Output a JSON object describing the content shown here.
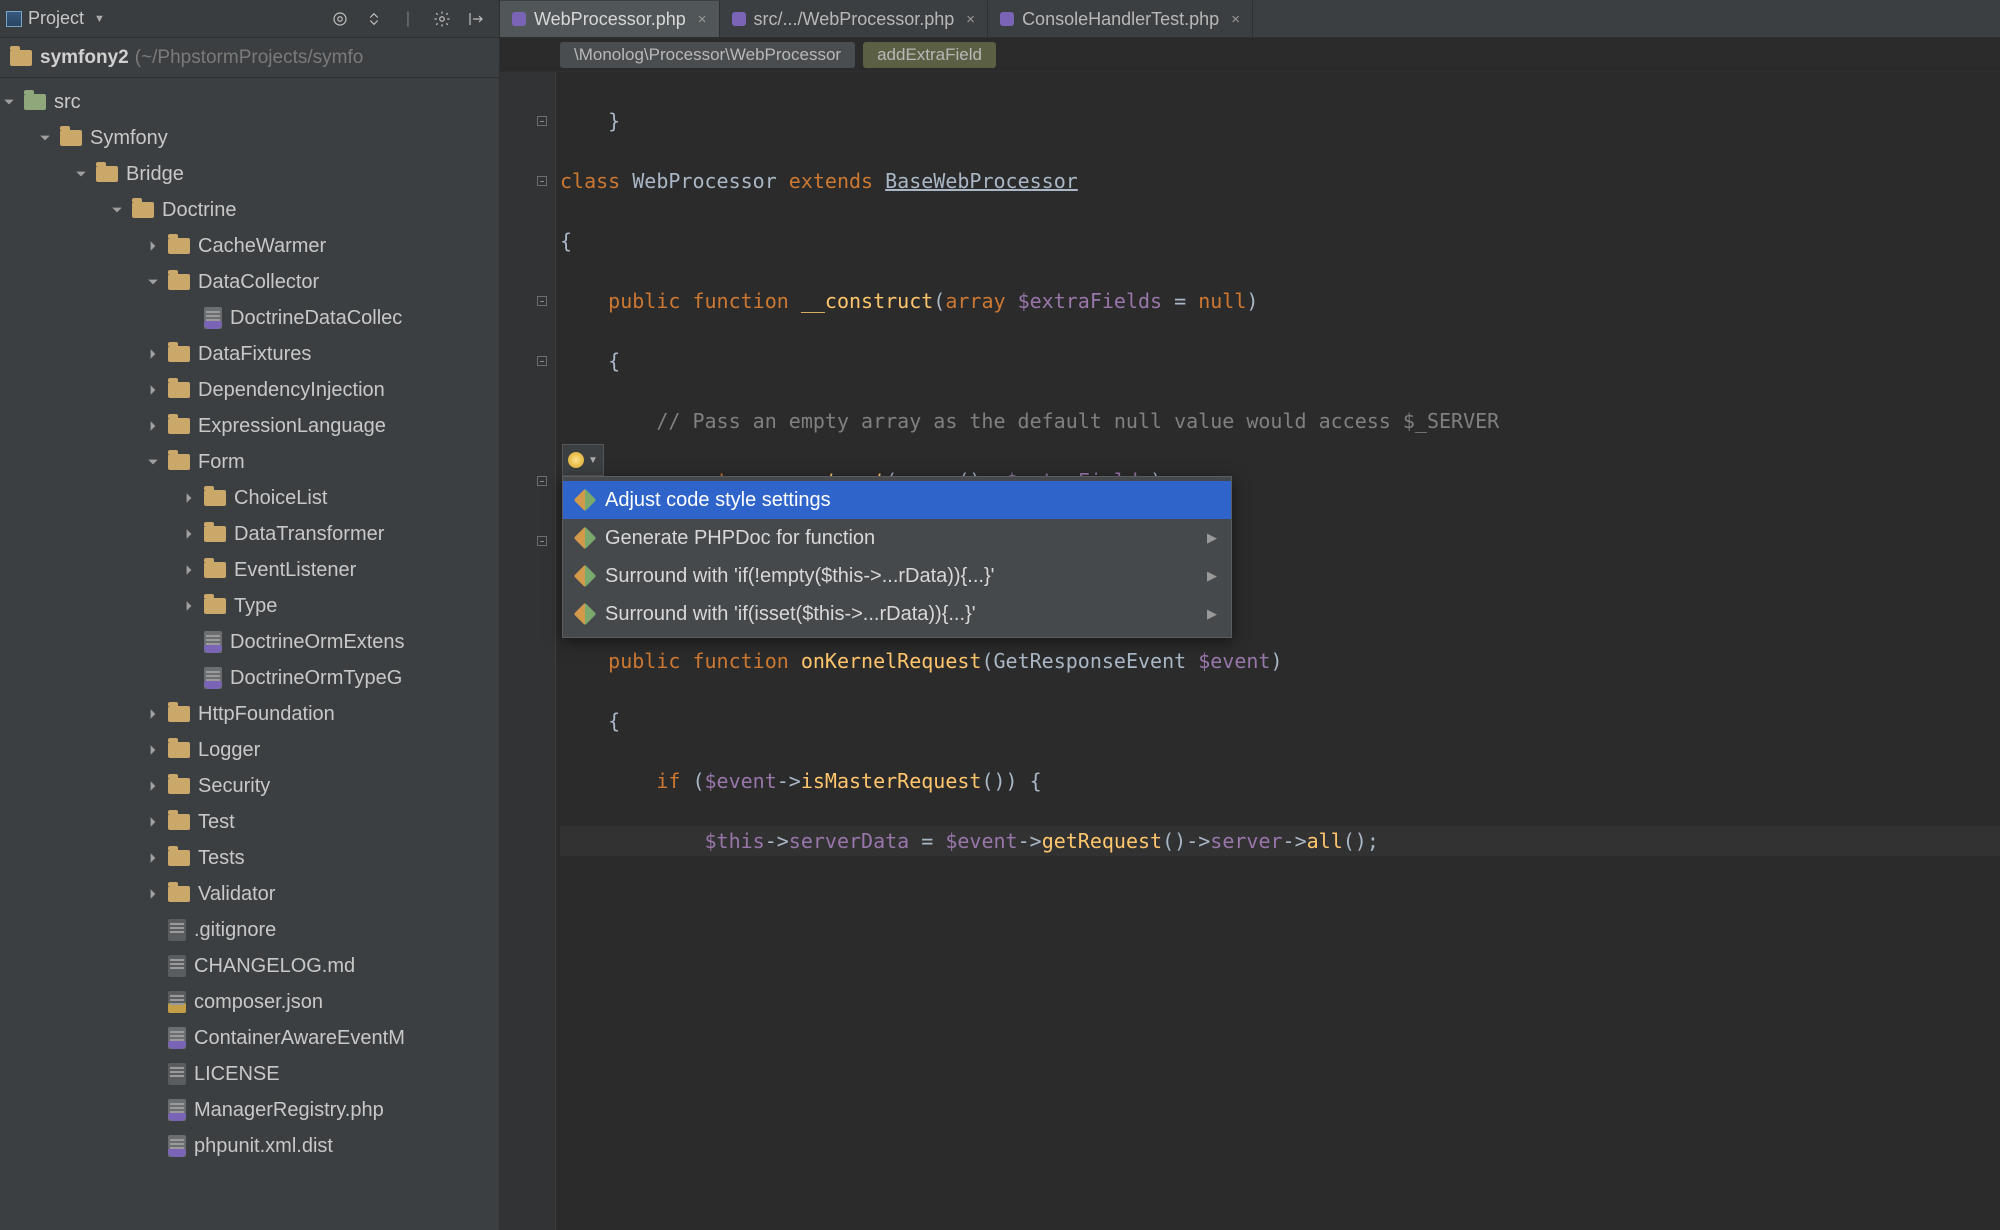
{
  "sidebar": {
    "title": "Project",
    "root_name": "symfony2",
    "root_path": "(~/PhpstormProjects/symfo",
    "tree": [
      {
        "depth": 0,
        "arr": "down",
        "icon": "folder-special",
        "label": "src"
      },
      {
        "depth": 1,
        "arr": "down",
        "icon": "folder",
        "label": "Symfony"
      },
      {
        "depth": 2,
        "arr": "down",
        "icon": "folder",
        "label": "Bridge"
      },
      {
        "depth": 3,
        "arr": "down",
        "icon": "folder",
        "label": "Doctrine"
      },
      {
        "depth": 4,
        "arr": "right",
        "icon": "folder",
        "label": "CacheWarmer"
      },
      {
        "depth": 4,
        "arr": "down",
        "icon": "folder",
        "label": "DataCollector"
      },
      {
        "depth": 5,
        "arr": "none",
        "icon": "php",
        "label": "DoctrineDataCollec"
      },
      {
        "depth": 4,
        "arr": "right",
        "icon": "folder",
        "label": "DataFixtures"
      },
      {
        "depth": 4,
        "arr": "right",
        "icon": "folder",
        "label": "DependencyInjection"
      },
      {
        "depth": 4,
        "arr": "right",
        "icon": "folder",
        "label": "ExpressionLanguage"
      },
      {
        "depth": 4,
        "arr": "down",
        "icon": "folder",
        "label": "Form"
      },
      {
        "depth": 5,
        "arr": "right",
        "icon": "folder",
        "label": "ChoiceList"
      },
      {
        "depth": 5,
        "arr": "right",
        "icon": "folder",
        "label": "DataTransformer"
      },
      {
        "depth": 5,
        "arr": "right",
        "icon": "folder",
        "label": "EventListener"
      },
      {
        "depth": 5,
        "arr": "right",
        "icon": "folder",
        "label": "Type"
      },
      {
        "depth": 5,
        "arr": "none",
        "icon": "php",
        "label": "DoctrineOrmExtens"
      },
      {
        "depth": 5,
        "arr": "none",
        "icon": "php",
        "label": "DoctrineOrmTypeG"
      },
      {
        "depth": 4,
        "arr": "right",
        "icon": "folder",
        "label": "HttpFoundation"
      },
      {
        "depth": 4,
        "arr": "right",
        "icon": "folder",
        "label": "Logger"
      },
      {
        "depth": 4,
        "arr": "right",
        "icon": "folder",
        "label": "Security"
      },
      {
        "depth": 4,
        "arr": "right",
        "icon": "folder",
        "label": "Test"
      },
      {
        "depth": 4,
        "arr": "right",
        "icon": "folder",
        "label": "Tests"
      },
      {
        "depth": 4,
        "arr": "right",
        "icon": "folder",
        "label": "Validator"
      },
      {
        "depth": 4,
        "arr": "none",
        "icon": "file",
        "label": ".gitignore"
      },
      {
        "depth": 4,
        "arr": "none",
        "icon": "file",
        "label": "CHANGELOG.md"
      },
      {
        "depth": 4,
        "arr": "none",
        "icon": "json",
        "label": "composer.json"
      },
      {
        "depth": 4,
        "arr": "none",
        "icon": "php",
        "label": "ContainerAwareEventM"
      },
      {
        "depth": 4,
        "arr": "none",
        "icon": "file",
        "label": "LICENSE"
      },
      {
        "depth": 4,
        "arr": "none",
        "icon": "php",
        "label": "ManagerRegistry.php"
      },
      {
        "depth": 4,
        "arr": "none",
        "icon": "php",
        "label": "phpunit.xml.dist"
      }
    ]
  },
  "tabs": [
    {
      "label": "WebProcessor.php",
      "active": true
    },
    {
      "label": "src/.../WebProcessor.php",
      "active": false
    },
    {
      "label": "ConsoleHandlerTest.php",
      "active": false
    }
  ],
  "crumbs": [
    {
      "label": "\\Monolog\\Processor\\WebProcessor",
      "hl": false
    },
    {
      "label": "addExtraField",
      "hl": true
    }
  ],
  "code": {
    "l1": "    }",
    "l2_a": "class ",
    "l2_b": "WebProcessor ",
    "l2_c": "extends ",
    "l2_d": "BaseWebProcessor",
    "l3": "{",
    "l4_a": "    public function ",
    "l4_b": "__construct",
    "l4_c": "(",
    "l4_d": "array ",
    "l4_e": "$extraFields",
    "l4_f": " = ",
    "l4_g": "null",
    "l4_h": ")",
    "l5": "    {",
    "l6": "        // Pass an empty array as the default null value would access $_SERVER",
    "l7_a": "        parent",
    "l7_b": "::",
    "l7_c": "__construct",
    "l7_d": "(",
    "l7_e": "array",
    "l7_f": "(), ",
    "l7_g": "$extraFields",
    "l7_h": ");",
    "l8": "    }",
    "l9": "",
    "l10_a": "    public function ",
    "l10_b": "onKernelRequest",
    "l10_c": "(GetResponseEvent ",
    "l10_d": "$event",
    "l10_e": ")",
    "l11": "    {",
    "l12_a": "        if ",
    "l12_b": "(",
    "l12_c": "$event",
    "l12_d": "->",
    "l12_e": "isMasterRequest",
    "l12_f": "()) {",
    "l13_a": "            $this",
    "l13_b": "->",
    "l13_c": "serverData",
    "l13_d": " = ",
    "l13_e": "$event",
    "l13_f": "->",
    "l13_g": "getRequest",
    "l13_h": "()->",
    "l13_i": "server",
    "l13_j": "->",
    "l13_k": "all",
    "l13_l": "();"
  },
  "popup": [
    {
      "label": "Adjust code style settings",
      "submenu": false,
      "selected": true
    },
    {
      "label": "Generate PHPDoc for function",
      "submenu": true,
      "selected": false
    },
    {
      "label": "Surround with 'if(!empty($this->...rData)){...}'",
      "submenu": true,
      "selected": false
    },
    {
      "label": "Surround with 'if(isset($this->...rData)){...}'",
      "submenu": true,
      "selected": false
    }
  ]
}
